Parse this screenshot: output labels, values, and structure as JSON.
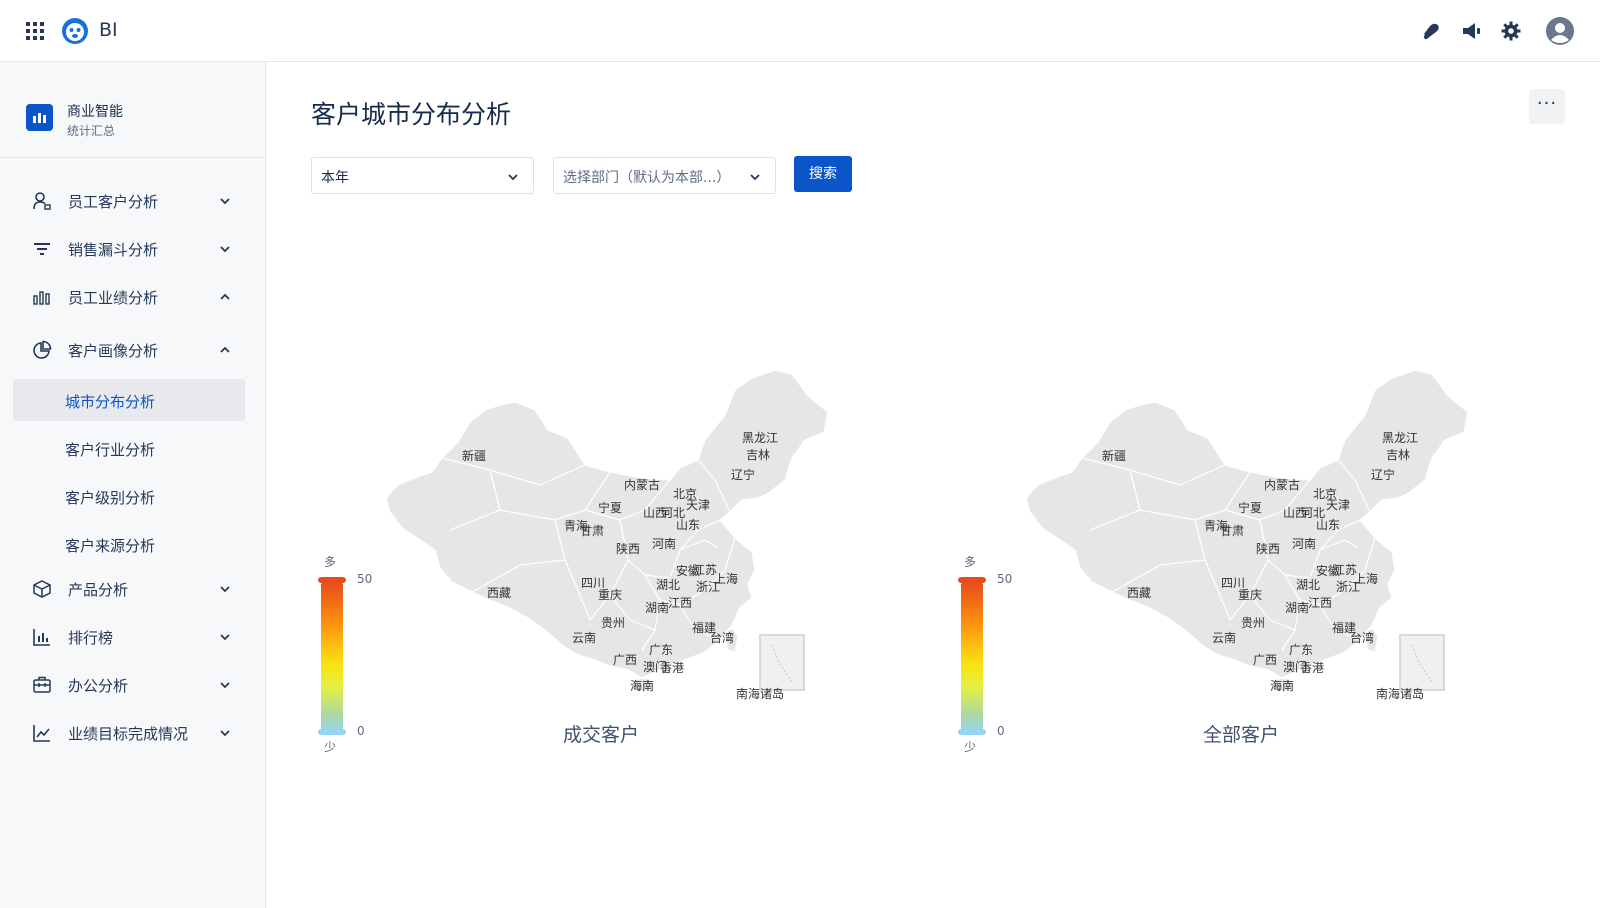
{
  "app": {
    "name": "BI"
  },
  "header_icons": [
    "bell-icon",
    "megaphone-icon",
    "gear-icon",
    "avatar-icon"
  ],
  "sidebar": {
    "brand": {
      "title": "商业智能",
      "subtitle": "统计汇总"
    },
    "items": [
      {
        "label": "员工客户分析",
        "icon": "user-icon",
        "expanded": false
      },
      {
        "label": "销售漏斗分析",
        "icon": "filter-icon",
        "expanded": false
      },
      {
        "label": "员工业绩分析",
        "icon": "bar-chart-icon",
        "expanded": true
      },
      {
        "label": "客户画像分析",
        "icon": "pie-chart-icon",
        "expanded": true
      },
      {
        "label": "产品分析",
        "icon": "box-icon",
        "expanded": false
      },
      {
        "label": "排行榜",
        "icon": "ranking-icon",
        "expanded": false
      },
      {
        "label": "办公分析",
        "icon": "briefcase-icon",
        "expanded": false
      },
      {
        "label": "业绩目标完成情况",
        "icon": "trend-icon",
        "expanded": false
      }
    ],
    "subitems": [
      {
        "label": "城市分布分析",
        "active": true
      },
      {
        "label": "客户行业分析",
        "active": false
      },
      {
        "label": "客户级别分析",
        "active": false
      },
      {
        "label": "客户来源分析",
        "active": false
      }
    ]
  },
  "main": {
    "title": "客户城市分布分析",
    "filters": {
      "period": "本年",
      "department_placeholder": "选择部门（默认为本部...）",
      "search_label": "搜索"
    },
    "more_label": "···"
  },
  "colors": {
    "accent": "#0c55c8",
    "legend_high": "#e84c1c",
    "legend_low": "#96d4f2"
  },
  "chart_data": [
    {
      "type": "map",
      "title": "成交客户",
      "legend": {
        "high_label": "多",
        "low_label": "少",
        "max": 50,
        "min": 0,
        "max_label": "50",
        "min_label": "0"
      },
      "regions": [
        "黑龙江",
        "吉林",
        "辽宁",
        "新疆",
        "内蒙古",
        "北京",
        "天津",
        "宁夏",
        "山西",
        "河北",
        "青海",
        "甘肃",
        "山东",
        "陕西",
        "河南",
        "西藏",
        "四川",
        "重庆",
        "安徽",
        "江苏",
        "上海",
        "湖北",
        "浙江",
        "湖南",
        "江西",
        "贵州",
        "福建",
        "云南",
        "台湾",
        "广东",
        "广西",
        "澳门",
        "香港",
        "海南",
        "南海诸岛"
      ]
    },
    {
      "type": "map",
      "title": "全部客户",
      "legend": {
        "high_label": "多",
        "low_label": "少",
        "max": 50,
        "min": 0,
        "max_label": "50",
        "min_label": "0"
      },
      "regions": [
        "黑龙江",
        "吉林",
        "辽宁",
        "新疆",
        "内蒙古",
        "北京",
        "天津",
        "宁夏",
        "山西",
        "河北",
        "青海",
        "甘肃",
        "山东",
        "陕西",
        "河南",
        "西藏",
        "四川",
        "重庆",
        "安徽",
        "江苏",
        "上海",
        "湖北",
        "浙江",
        "湖南",
        "江西",
        "贵州",
        "福建",
        "云南",
        "台湾",
        "广东",
        "广西",
        "澳门",
        "香港",
        "海南",
        "南海诸岛"
      ]
    }
  ]
}
